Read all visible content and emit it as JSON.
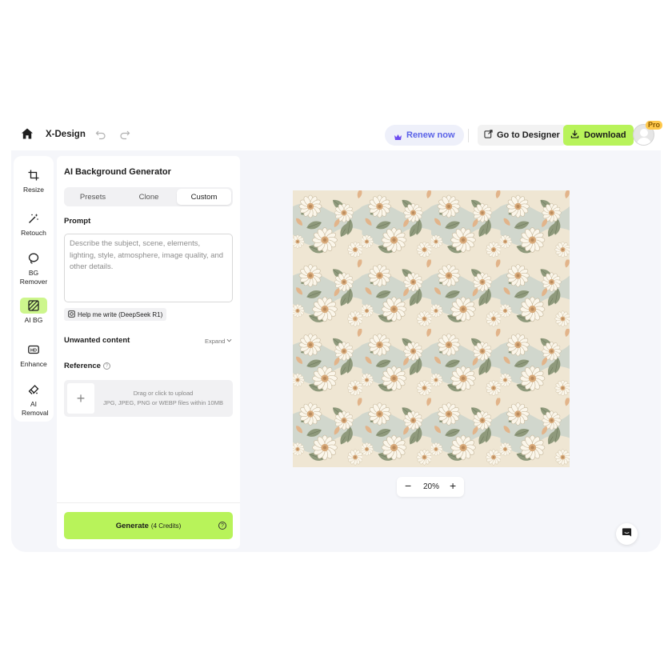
{
  "app": {
    "name": "X-Design"
  },
  "header": {
    "renew_label": "Renew now",
    "goto_label": "Go to Designer",
    "download_label": "Download",
    "pro_badge": "Pro"
  },
  "colors": {
    "accent_green": "#b8f35a",
    "renew_purple": "#5b63e8",
    "workspace_bg": "#f5f6fa"
  },
  "tools": [
    {
      "label": "Resize",
      "icon": "crop-icon",
      "active": false
    },
    {
      "label": "Retouch",
      "icon": "magic-wand-icon",
      "active": false
    },
    {
      "label": "BG Remover",
      "icon": "lasso-icon",
      "active": false
    },
    {
      "label": "AI BG",
      "icon": "ai-background-icon",
      "active": true
    },
    {
      "label": "Enhance",
      "icon": "hd-icon",
      "active": false
    },
    {
      "label": "AI Removal",
      "icon": "eraser-icon",
      "active": false
    }
  ],
  "panel": {
    "title": "AI Background Generator",
    "tabs": [
      {
        "label": "Presets",
        "active": false
      },
      {
        "label": "Clone",
        "active": false
      },
      {
        "label": "Custom",
        "active": true
      }
    ],
    "prompt_label": "Prompt",
    "prompt_placeholder": "Describe the subject, scene, elements, lighting, style, atmosphere, image quality, and other details.",
    "help_write_label": "Help me write (DeepSeek R1)",
    "unwanted_label": "Unwanted content",
    "expand_label": "Expand",
    "reference_label": "Reference",
    "upload_line1": "Drag or click to upload",
    "upload_line2": "JPG, JPEG, PNG or WEBP files within 10MB",
    "generate_label": "Generate",
    "generate_credits": "(4 Credits)"
  },
  "canvas": {
    "image_description_icon": "floral-pattern-image",
    "zoom": "20%"
  }
}
